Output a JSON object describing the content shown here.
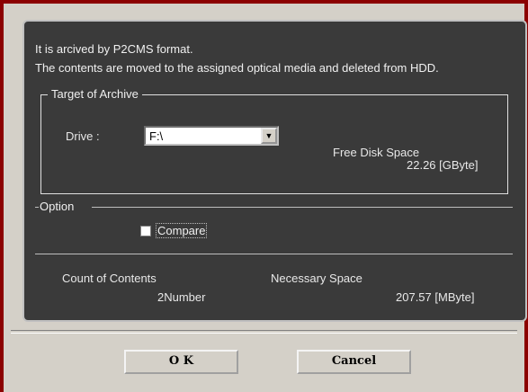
{
  "info": {
    "line1": "It is arcived by P2CMS format.",
    "line2": "The contents are moved to the assigned optical media and deleted from HDD."
  },
  "target": {
    "legend": "Target of Archive",
    "drive_label": "Drive :",
    "drive_value": "F:\\",
    "free_label": "Free Disk Space",
    "free_value": "22.26 [GByte]"
  },
  "option": {
    "legend": "Option",
    "compare_label": "Compare",
    "compare_checked": false
  },
  "stats": {
    "count_label": "Count of Contents",
    "count_value": "2Number",
    "space_label": "Necessary Space",
    "space_value": "207.57 [MByte]"
  },
  "buttons": {
    "ok": "O K",
    "cancel": "Cancel"
  },
  "colors": {
    "frame": "#8b0000",
    "panel": "#3a3a3a",
    "dialog": "#d4d0c8"
  }
}
